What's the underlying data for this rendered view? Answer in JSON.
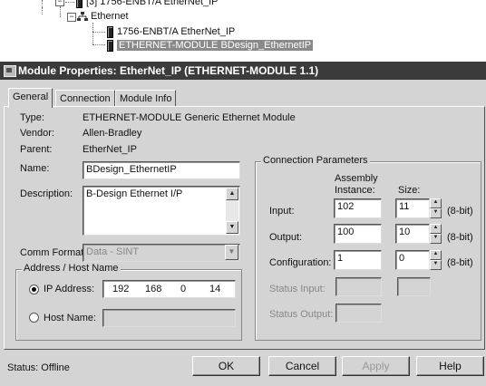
{
  "tree": {
    "top_node": "[3] 1756-ENBT/A EtherNet_IP",
    "ethernet": "Ethernet",
    "children": [
      "1756-ENBT/A EtherNet_IP",
      "ETHERNET-MODULE BDesign_EthernetIP"
    ]
  },
  "dialog": {
    "title": "Module Properties: EtherNet_IP (ETHERNET-MODULE 1.1)",
    "tabs": [
      "General",
      "Connection",
      "Module Info"
    ],
    "type_label": "Type:",
    "type_value": "ETHERNET-MODULE Generic Ethernet Module",
    "vendor_label": "Vendor:",
    "vendor_value": "Allen-Bradley",
    "parent_label": "Parent:",
    "parent_value": "EtherNet_IP",
    "name_label": "Name:",
    "name_value": "BDesign_EthernetIP",
    "description_label": "Description:",
    "description_value": "B-Design Ethernet I/P",
    "comm_format_label": "Comm Format:",
    "comm_format_value": "Data - SINT",
    "address_group_title": "Address / Host Name",
    "ip_address_label": "IP Address:",
    "ip_octets": [
      "192",
      "168",
      "0",
      "14"
    ],
    "host_name_label": "Host Name:",
    "host_name_value": "",
    "conn_group_title": "Connection Parameters",
    "assembly_header": "Assembly",
    "instance_header": "Instance:",
    "size_header": "Size:",
    "input_label": "Input:",
    "input_instance": "102",
    "input_size": "11",
    "input_unit": "(8-bit)",
    "output_label": "Output:",
    "output_instance": "100",
    "output_size": "10",
    "output_unit": "(8-bit)",
    "config_label": "Configuration:",
    "config_instance": "1",
    "config_size": "0",
    "config_unit": "(8-bit)",
    "status_input_label": "Status Input:",
    "status_output_label": "Status Output:",
    "status_text": "Status:  Offline",
    "buttons": {
      "ok": "OK",
      "cancel": "Cancel",
      "apply": "Apply",
      "help": "Help"
    }
  }
}
